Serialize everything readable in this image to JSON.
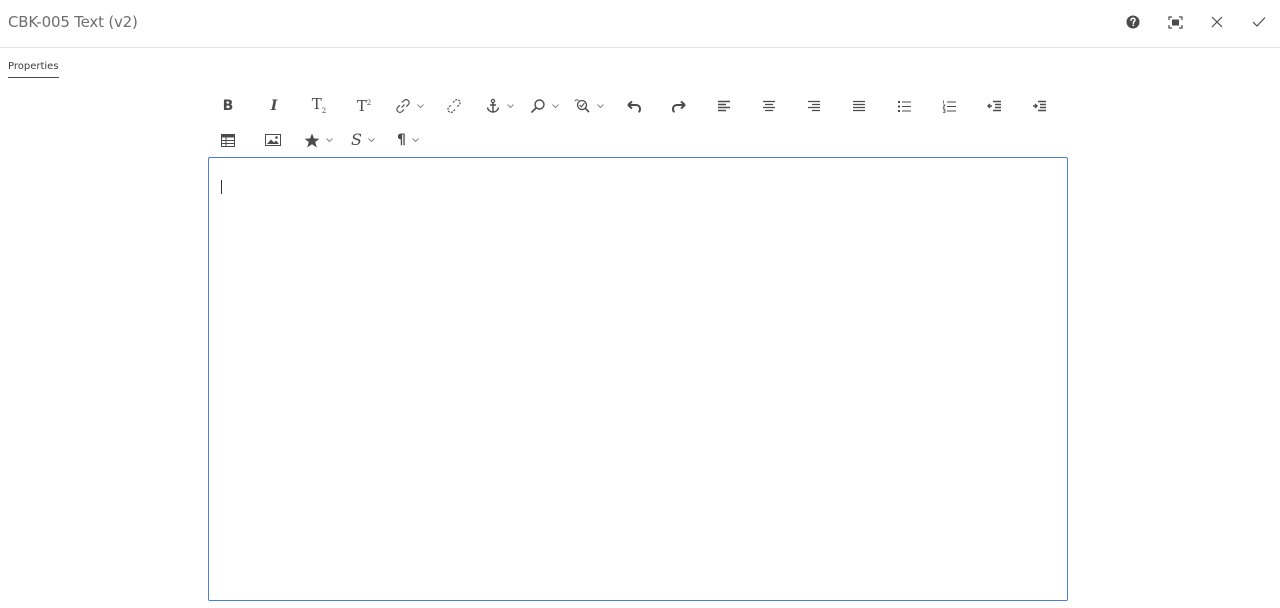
{
  "dialog": {
    "title": "CBK-005 Text (v2)"
  },
  "header_actions": [
    {
      "name": "help-icon"
    },
    {
      "name": "fullscreen-icon"
    },
    {
      "name": "close-icon"
    },
    {
      "name": "confirm-check-icon"
    }
  ],
  "tabs": [
    {
      "label": "Properties",
      "active": true
    }
  ],
  "toolbar": {
    "bold": "B",
    "italic": "I",
    "subscript": "T",
    "superscript": "T",
    "strike": "S",
    "paragraph": "¶"
  },
  "editor": {
    "content": ""
  },
  "colors": {
    "editor_border": "#4a7fd1",
    "header_border": "#e6e6e6",
    "icon": "#4b4b4b"
  }
}
